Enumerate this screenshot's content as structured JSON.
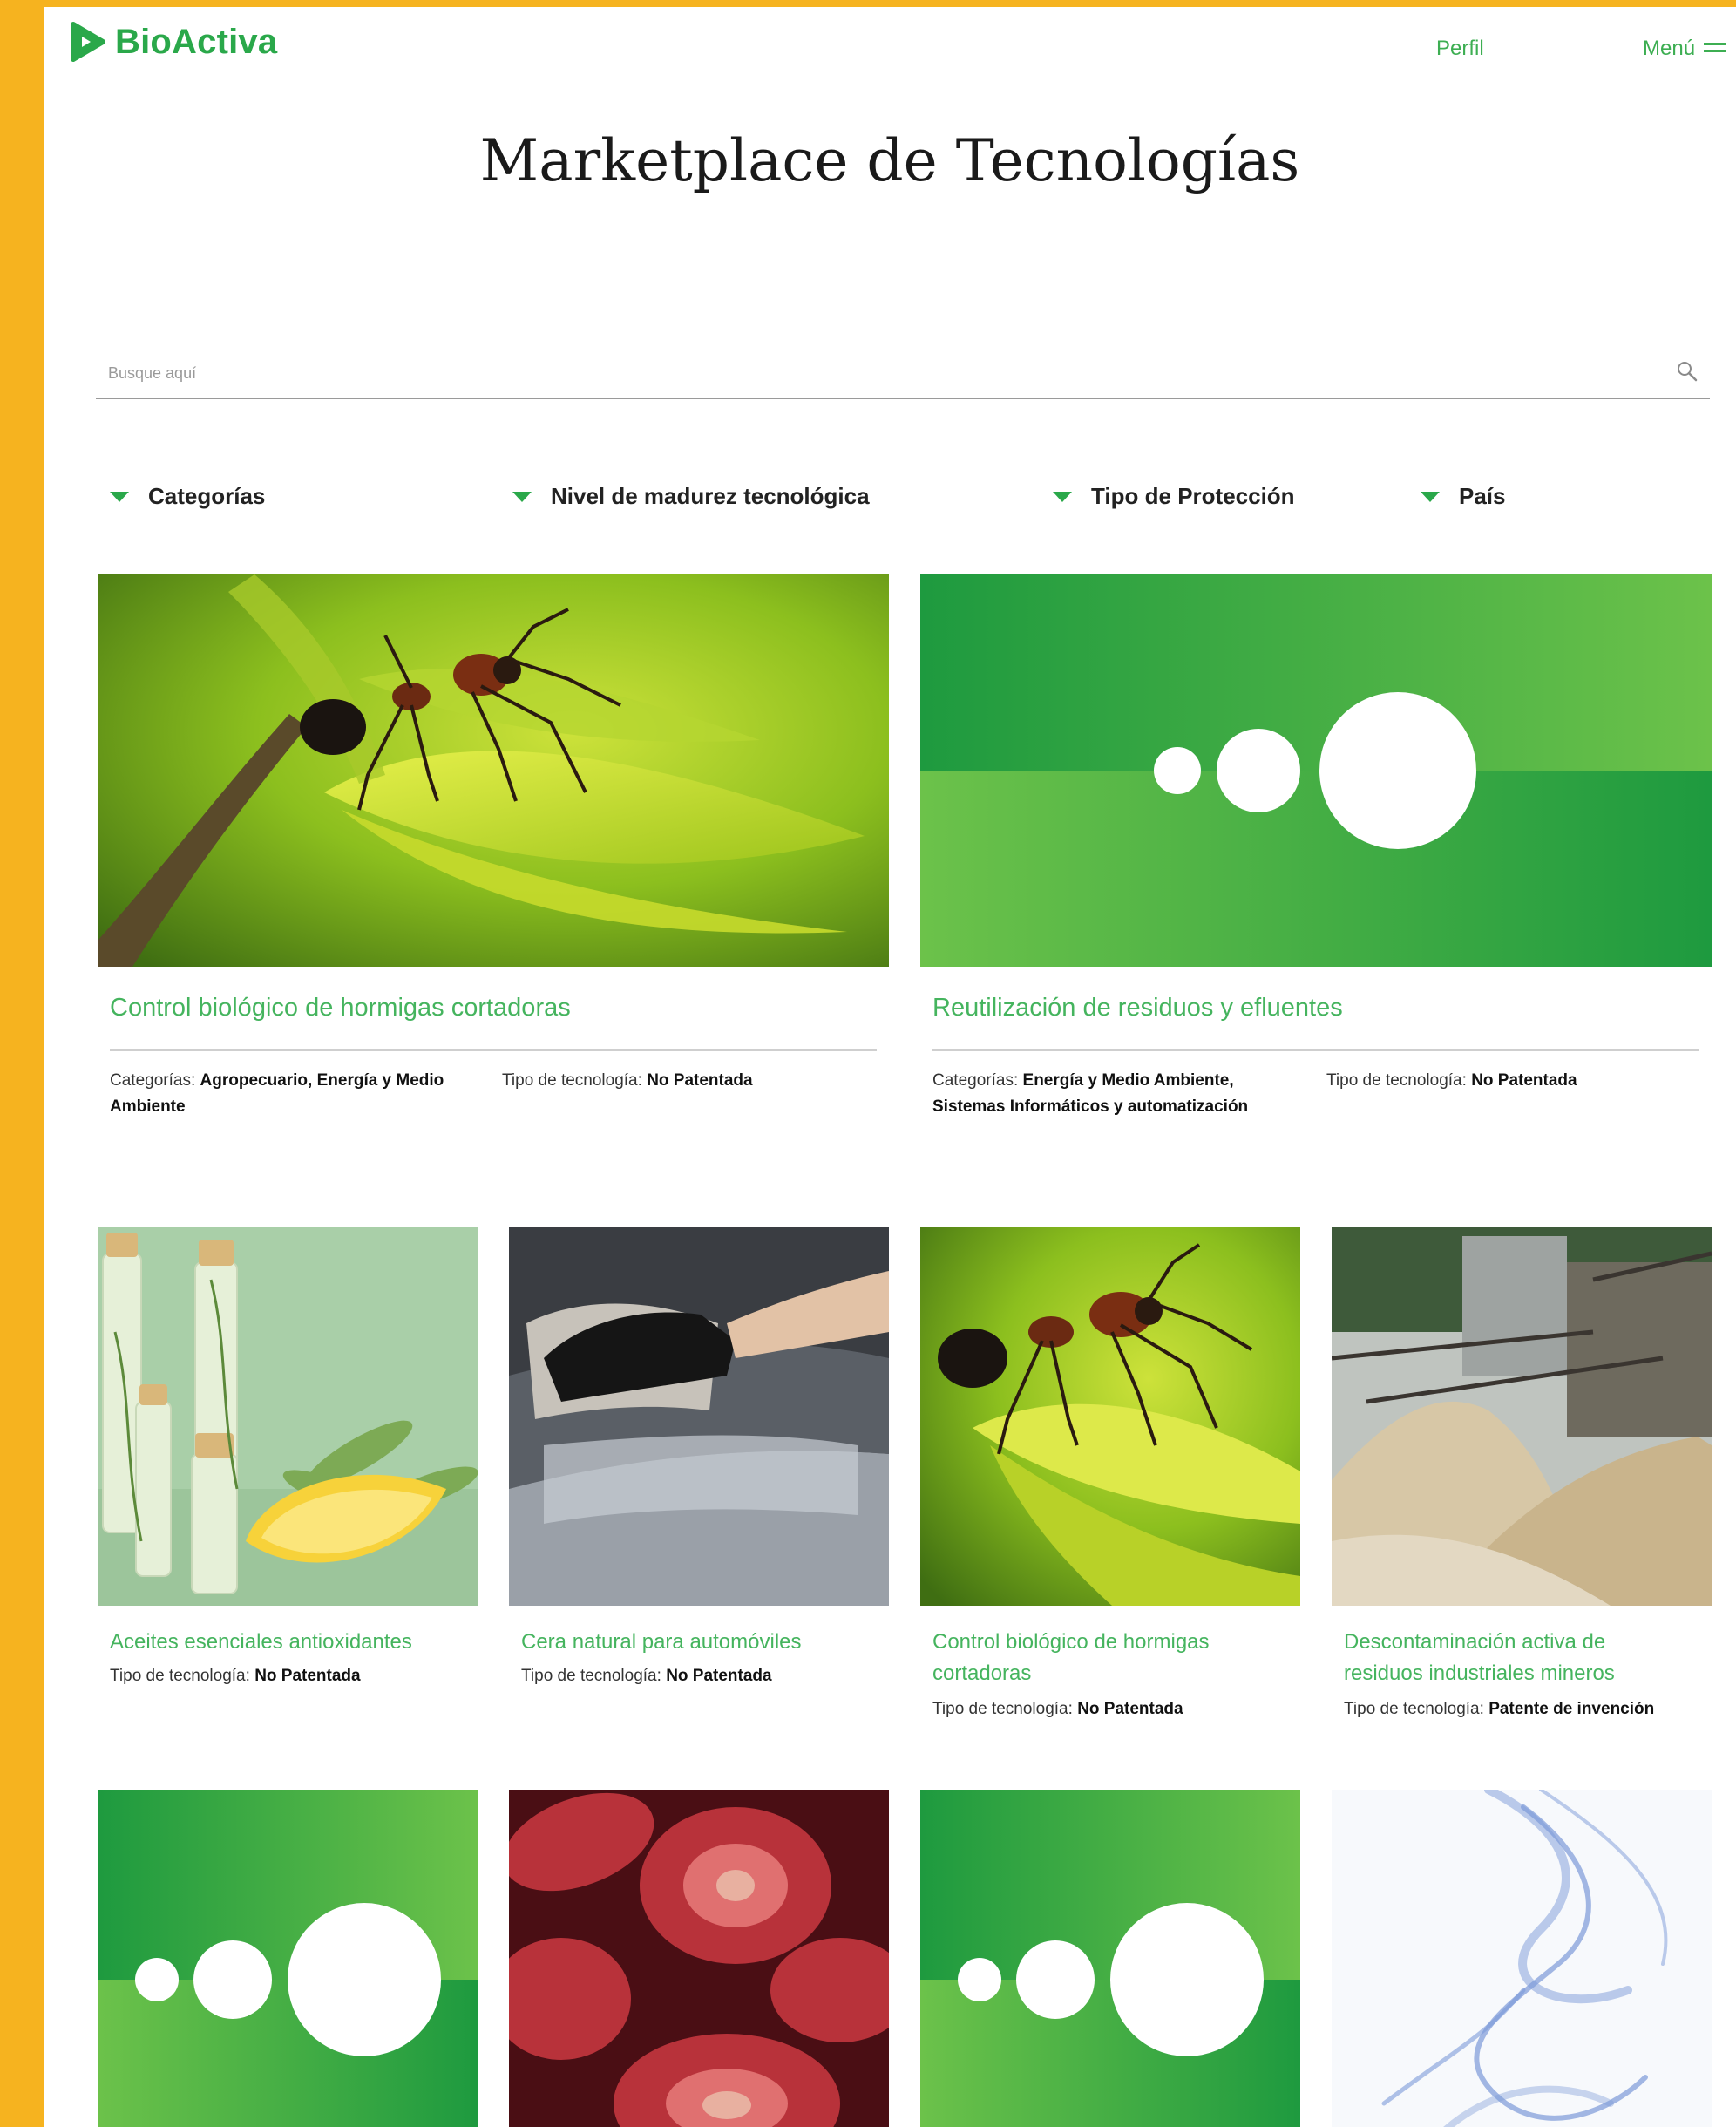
{
  "brand": {
    "name": "BioActiva",
    "color": "#2AA84A"
  },
  "nav": {
    "perfil": "Perfil",
    "menu": "Menú"
  },
  "page_title": "Marketplace de Tecnologías",
  "search": {
    "placeholder": "Busque aquí",
    "value": ""
  },
  "filters": [
    {
      "label": "Categorías"
    },
    {
      "label": "Nivel de madurez tecnológica"
    },
    {
      "label": "Tipo de Protección"
    },
    {
      "label": "País"
    }
  ],
  "featured": [
    {
      "title": "Control biológico de hormigas cortadoras",
      "image": "ant-on-leaf",
      "categories_label": "Categorías:",
      "categories_value": "Agropecuario, Energía y Medio Ambiente",
      "type_label": "Tipo de tecnología:",
      "type_value": "No Patentada"
    },
    {
      "title": "Reutilización de residuos y efluentes",
      "image": "green-circles-banner",
      "categories_label": "Categorías:",
      "categories_value": "Energía y Medio Ambiente, Sistemas Informáticos y automatización",
      "type_label": "Tipo de tecnología:",
      "type_value": "No Patentada"
    }
  ],
  "grid": [
    {
      "title": "Aceites esenciales antioxidantes",
      "image": "oil-bottles-lemon",
      "type_label": "Tipo de tecnología:",
      "type_value": "No Patentada"
    },
    {
      "title": "Cera natural para automóviles",
      "image": "gloved-hand-car",
      "type_label": "Tipo de tecnología:",
      "type_value": "No Patentada"
    },
    {
      "title": "Control biológico de hormigas cortadoras",
      "image": "ant-on-leaf",
      "type_label": "Tipo de tecnología:",
      "type_value": "No Patentada"
    },
    {
      "title": "Descontaminación activa de residuos industriales mineros",
      "image": "mining-sand-piles",
      "type_label": "Tipo de tecnología:",
      "type_value": "Patente de invención"
    }
  ],
  "bottom_row": [
    {
      "image": "green-circles-banner"
    },
    {
      "image": "dried-strawberries"
    },
    {
      "image": "green-circles-banner"
    },
    {
      "image": "blue-smoke"
    }
  ]
}
